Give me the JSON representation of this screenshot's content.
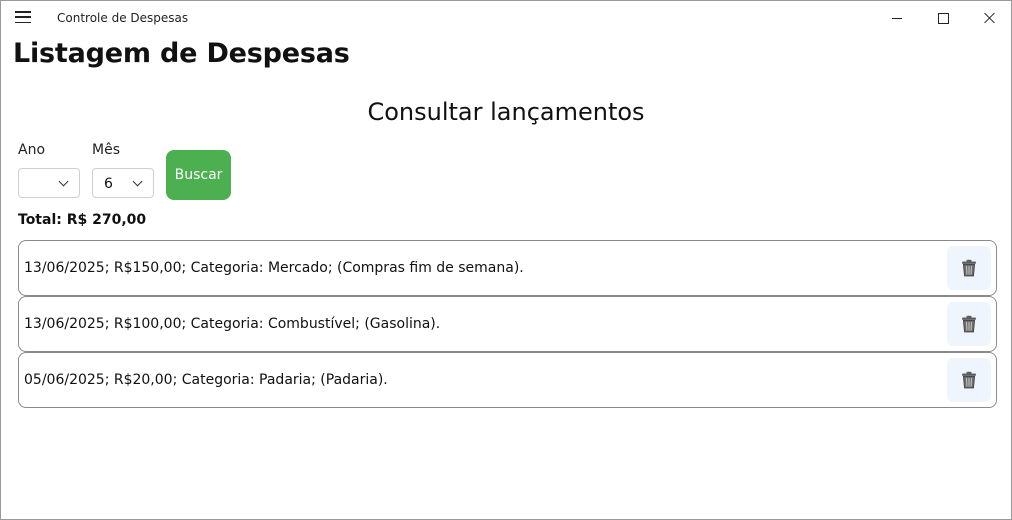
{
  "window": {
    "title": "Controle de Despesas",
    "menu_icon": "hamburger-menu-icon",
    "controls": [
      "minimize-icon",
      "maximize-icon",
      "close-icon"
    ]
  },
  "page": {
    "title": "Listagem de Despesas",
    "section_title": "Consultar lançamentos"
  },
  "filters": {
    "ano": {
      "label": "Ano",
      "value": ""
    },
    "mes": {
      "label": "Mês",
      "value": "6"
    },
    "search_button": "Buscar",
    "search_button_color": "#4caf50"
  },
  "summary": {
    "total": "Total: R$ 270,00"
  },
  "expenses": [
    {
      "text": "13/06/2025; R$150,00; Categoria: Mercado; (Compras fim de semana).",
      "delete_icon": "trash-icon"
    },
    {
      "text": "13/06/2025; R$100,00; Categoria: Combustível; (Gasolina).",
      "delete_icon": "trash-icon"
    },
    {
      "text": "05/06/2025; R$20,00; Categoria: Padaria; (Padaria).",
      "delete_icon": "trash-icon"
    }
  ]
}
